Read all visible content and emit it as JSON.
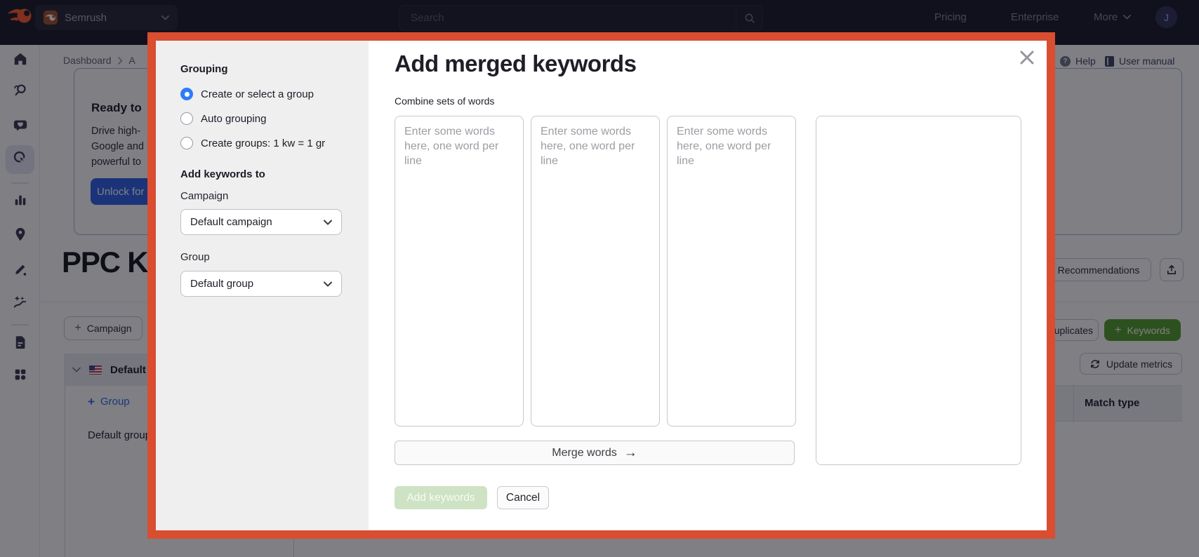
{
  "topbar": {
    "brand": "Semrush",
    "search_placeholder": "Search",
    "links": [
      "Pricing",
      "Enterprise",
      "More"
    ],
    "avatar_initial": "J"
  },
  "breadcrumb": {
    "items": [
      "Dashboard",
      "A"
    ]
  },
  "promo": {
    "title": "Ready to",
    "lines": [
      "Drive high-",
      "Google and",
      "powerful to"
    ],
    "cta": "Unlock for"
  },
  "page": {
    "heading": "PPC Keywords"
  },
  "header_links": {
    "help": "Help",
    "user_manual": "User manual"
  },
  "toolbar": {
    "recommendations": "Recommendations",
    "campaign": "Campaign",
    "remove_duplicates": "Remove duplicates",
    "keywords": "Keywords",
    "update_metrics": "Update metrics"
  },
  "table": {
    "match_type": "Match type",
    "campaign_row": "Default campaign",
    "add_group": "Group",
    "group_row": "Default group"
  },
  "modal": {
    "title": "Add merged keywords",
    "subtitle": "Combine sets of words",
    "grouping_label": "Grouping",
    "grouping_options": [
      "Create or select a group",
      "Auto grouping",
      "Create groups: 1 kw = 1 gr"
    ],
    "grouping_selected_index": 0,
    "add_keywords_to_label": "Add keywords to",
    "campaign_label": "Campaign",
    "campaign_value": "Default campaign",
    "group_label": "Group",
    "group_value": "Default group",
    "textarea_placeholder": "Enter some words here, one word per line",
    "merge_button": "Merge words",
    "add_button": "Add keywords",
    "cancel_button": "Cancel"
  },
  "icons": {
    "plus": "+",
    "arrow_right": "→",
    "question": "?"
  },
  "colors": {
    "modal_border": "#d94e30",
    "logo_orange": "#ff5a2a",
    "cta_blue": "#2f63e9",
    "radio_blue": "#2e7cf6",
    "keywords_green": "#55a02b",
    "link_blue": "#2e6bf0"
  }
}
